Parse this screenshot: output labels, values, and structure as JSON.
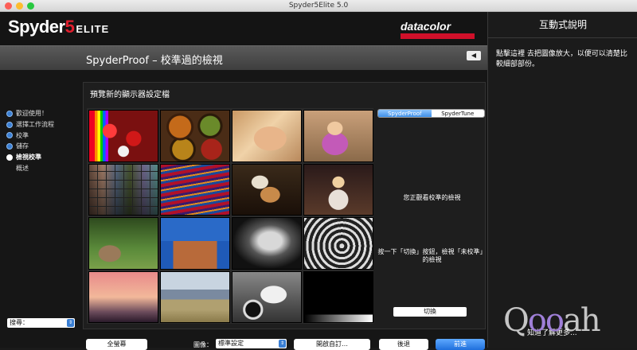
{
  "window": {
    "title": "Spyder5Elite 5.0"
  },
  "brand": {
    "logo_main": "Spyder",
    "logo_num": "5",
    "logo_edition": "ELITE",
    "partner": "datacolor"
  },
  "header": {
    "title": "SpyderProof – 校準過的檢視",
    "back_icon": "◀"
  },
  "steps": [
    {
      "label": "歡迎使用！",
      "state": "done"
    },
    {
      "label": "選擇工作流程",
      "state": "done"
    },
    {
      "label": "校準",
      "state": "done"
    },
    {
      "label": "儲存",
      "state": "done"
    },
    {
      "label": "檢視校準",
      "state": "active"
    },
    {
      "label": "概述",
      "state": "pending"
    }
  ],
  "search": {
    "value": "搜尋："
  },
  "panel": {
    "heading": "預覽新的顯示器設定檔",
    "tabs": [
      "SpyderProof",
      "SpyderTune"
    ],
    "message_1": "您正觀看校準的檢視",
    "message_2": "按一下「切換」按鈕，檢視「未校準」的檢視",
    "toggle_label": "切換"
  },
  "bottom": {
    "fullscreen_label": "全螢幕",
    "image_label": "圖像：",
    "image_select_value": "標準設定",
    "open_custom_label": "開啟自訂…",
    "back_label": "後退",
    "next_label": "前進"
  },
  "side": {
    "title": "互動式說明",
    "text": "點擊這裡 去把圖像放大，以便可以清楚比較細部部份。",
    "learn_more": "知道了解更多..."
  },
  "watermark": "Qooah",
  "colors": {
    "accent_blue": "#1f6fdc",
    "brand_red": "#e01e2d"
  }
}
